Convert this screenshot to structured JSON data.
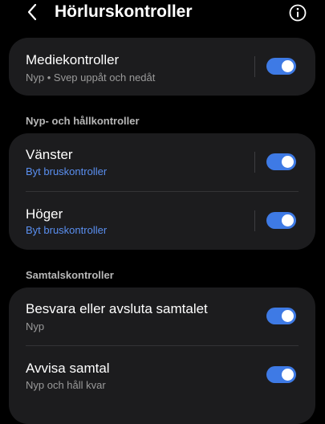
{
  "header": {
    "title": "Hörlurskontroller",
    "back_icon": "chevron-left-icon",
    "info_icon": "info-icon"
  },
  "media_card": {
    "title": "Mediekontroller",
    "subtitle": "Nyp • Svep uppåt och nedåt",
    "enabled": true
  },
  "pinch_section": {
    "label": "Nyp- och hållkontroller",
    "items": [
      {
        "title": "Vänster",
        "subtitle": "Byt bruskontroller",
        "enabled": true
      },
      {
        "title": "Höger",
        "subtitle": "Byt bruskontroller",
        "enabled": true
      }
    ]
  },
  "call_section": {
    "label": "Samtalskontroller",
    "items": [
      {
        "title": "Besvara eller avsluta samtalet",
        "subtitle": "Nyp",
        "enabled": true
      },
      {
        "title": "Avvisa samtal",
        "subtitle": "Nyp och håll kvar",
        "enabled": true
      }
    ]
  },
  "colors": {
    "background": "#000000",
    "card": "#1c1c1e",
    "accent": "#3e7ae5",
    "link": "#5a8ff0",
    "secondary_text": "#9a9a9a"
  }
}
